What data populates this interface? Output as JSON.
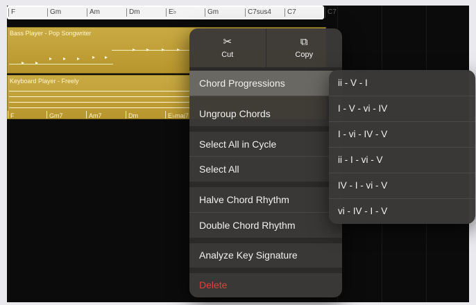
{
  "chord_track": {
    "chords": [
      "F",
      "Gm",
      "Am",
      "Dm",
      "E♭",
      "Gm",
      "C7sus4",
      "C7"
    ],
    "after_chord": "C7"
  },
  "regions": {
    "bass": {
      "title": "Bass Player - Pop Songwriter"
    },
    "keys": {
      "title": "Keyboard Player - Freely",
      "chords": [
        "F",
        "Gm7",
        "Am7",
        "Dm",
        "E♭maj7"
      ]
    }
  },
  "context_menu": {
    "cut_label": "Cut",
    "copy_label": "Copy",
    "items": {
      "chord_progressions": "Chord Progressions",
      "ungroup_chords": "Ungroup Chords",
      "select_all_in_cycle": "Select All in Cycle",
      "select_all": "Select All",
      "halve_chord_rhythm": "Halve Chord Rhythm",
      "double_chord_rhythm": "Double Chord Rhythm",
      "analyze_key_signature": "Analyze Key Signature",
      "delete": "Delete"
    }
  },
  "submenu": {
    "items": [
      "ii - V - I",
      "I - V - vi - IV",
      "I - vi - IV - V",
      "ii - I - vi - V",
      "IV - I - vi - V",
      "vi - IV - I - V"
    ]
  },
  "icons": {
    "cut": "scissors-icon",
    "copy": "copy-icon"
  },
  "colors": {
    "region": "#c9aa43",
    "menu_bg": "#3c3a38",
    "highlight": "#6a6862",
    "danger": "#e0413a"
  }
}
